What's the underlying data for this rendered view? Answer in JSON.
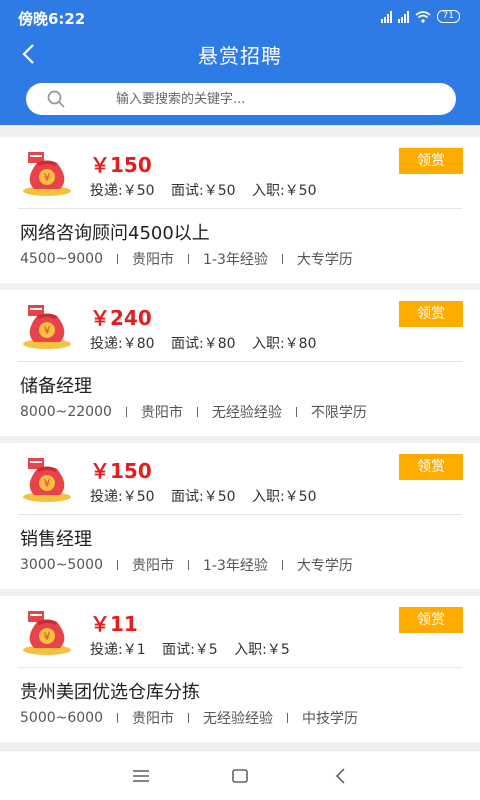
{
  "status_bar": {
    "time": "傍晚6:22",
    "battery": "71"
  },
  "header": {
    "title": "悬赏招聘"
  },
  "search": {
    "placeholder": "输入要搜索的关键字..."
  },
  "claim_label": "领赏",
  "jobs": [
    {
      "amount": "￥150",
      "deliver": "投递:￥50",
      "interview": "面试:￥50",
      "onboard": "入职:￥50",
      "title": "网络咨询顾问4500以上",
      "salary": "4500~9000",
      "city": "贵阳市",
      "experience": "1-3年经验",
      "education": "大专学历"
    },
    {
      "amount": "￥240",
      "deliver": "投递:￥80",
      "interview": "面试:￥80",
      "onboard": "入职:￥80",
      "title": "储备经理",
      "salary": "8000~22000",
      "city": "贵阳市",
      "experience": "无经验经验",
      "education": "不限学历"
    },
    {
      "amount": "￥150",
      "deliver": "投递:￥50",
      "interview": "面试:￥50",
      "onboard": "入职:￥50",
      "title": "销售经理",
      "salary": "3000~5000",
      "city": "贵阳市",
      "experience": "1-3年经验",
      "education": "大专学历"
    },
    {
      "amount": "￥11",
      "deliver": "投递:￥1",
      "interview": "面试:￥5",
      "onboard": "入职:￥5",
      "title": "贵州美团优选仓库分拣",
      "salary": "5000~6000",
      "city": "贵阳市",
      "experience": "无经验经验",
      "education": "中技学历"
    }
  ],
  "colors": {
    "header": "#2f7be5",
    "amount": "#e41e1e",
    "claim_button": "#ffab00"
  },
  "icons": {
    "back": "chevron-left-icon",
    "search": "search-icon",
    "bag": "money-bag-icon"
  }
}
